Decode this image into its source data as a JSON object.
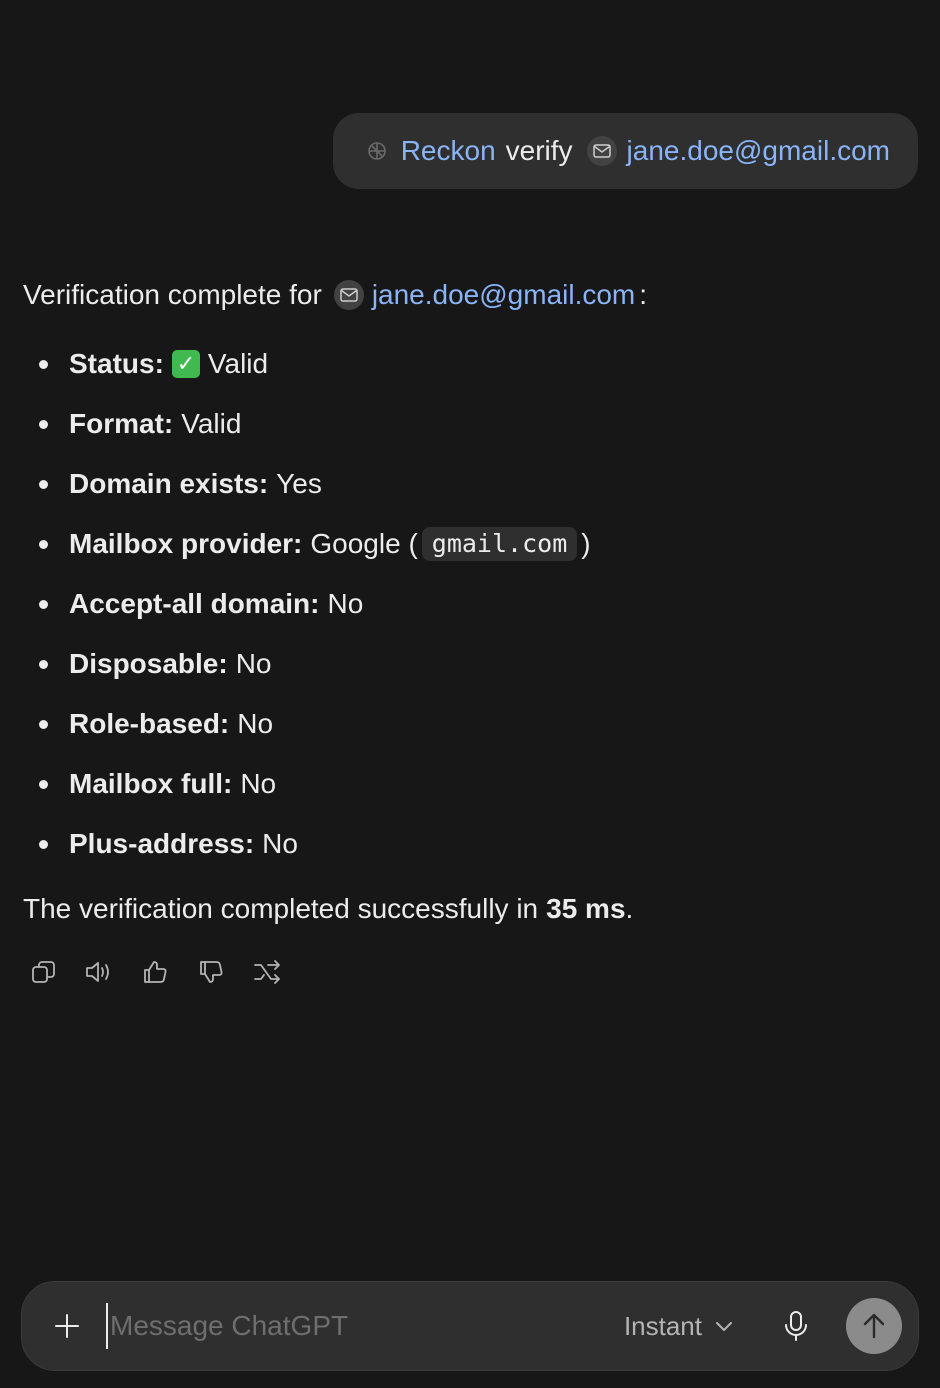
{
  "user_message": {
    "app_name": "Reckon",
    "verb": "verify",
    "email": "jane.doe@gmail.com"
  },
  "assistant": {
    "intro": "Verification complete for",
    "email": "jane.doe@gmail.com",
    "intro_suffix": ":",
    "items": [
      {
        "key": "Status:",
        "value": "Valid"
      },
      {
        "key": "Format:",
        "value": "Valid"
      },
      {
        "key": "Domain exists:",
        "value": "Yes"
      },
      {
        "key": "Mailbox provider:",
        "value": "Google (",
        "code": "gmail.com",
        "suffix": ")"
      },
      {
        "key": "Accept-all domain:",
        "value": "No"
      },
      {
        "key": "Disposable:",
        "value": "No"
      },
      {
        "key": "Role-based:",
        "value": "No"
      },
      {
        "key": "Mailbox full:",
        "value": "No"
      },
      {
        "key": "Plus-address:",
        "value": "No"
      }
    ],
    "summary": "The verification completed successfully in",
    "summary_time": "35 ms",
    "summary_end": ".",
    "status_icon": "check-emoji",
    "action_icons": [
      "copy-icon",
      "read-aloud-icon",
      "thumbs-up-icon",
      "thumbs-down-icon",
      "share-icon"
    ]
  },
  "composer": {
    "placeholder": "Message ChatGPT",
    "model": "Instant"
  },
  "colors": {
    "background": "#171717",
    "bubble": "#2f2f2f",
    "link": "#8ab4f8",
    "text": "#ececec",
    "send": "#8b8b8b"
  }
}
